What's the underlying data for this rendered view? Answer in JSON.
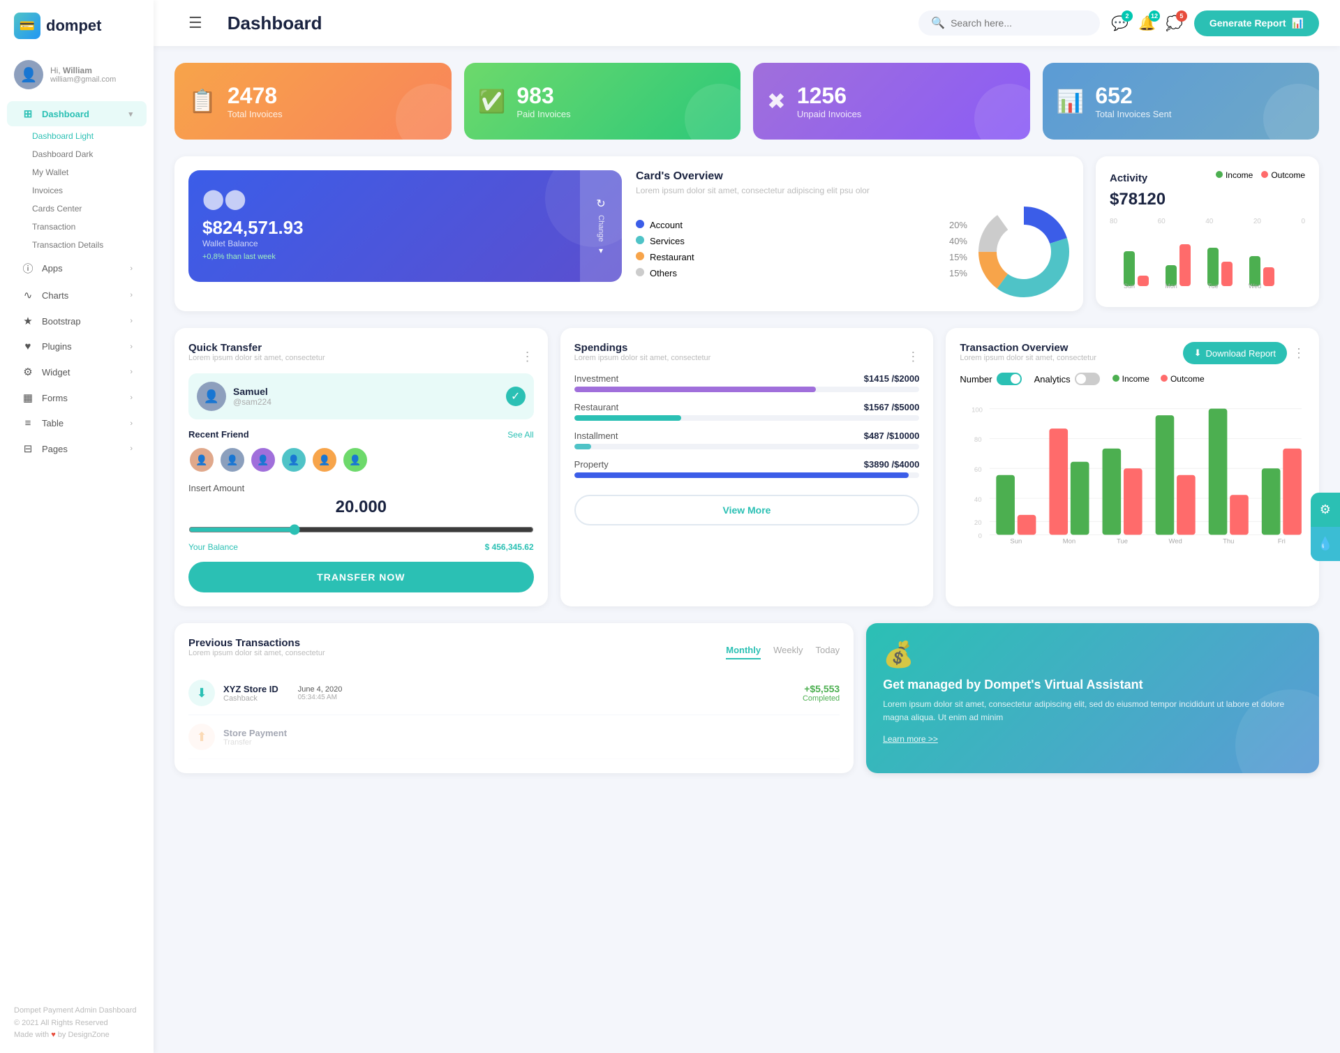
{
  "app": {
    "logo_text": "dompet",
    "page_title": "Dashboard",
    "footer_line1": "Dompet Payment Admin Dashboard",
    "footer_line2": "© 2021 All Rights Reserved",
    "footer_line3": "Made with ♥ by DesignZone"
  },
  "topbar": {
    "search_placeholder": "Search here...",
    "generate_btn": "Generate Report",
    "bell_badge": "12",
    "chat_badge": "2",
    "msg_badge": "5"
  },
  "user": {
    "greeting": "Hi, William",
    "name": "William",
    "email": "william@gmail.com"
  },
  "sidebar": {
    "items": [
      {
        "label": "Dashboard",
        "icon": "⊞",
        "active": true
      },
      {
        "label": "Apps",
        "icon": "ⓘ"
      },
      {
        "label": "Charts",
        "icon": "∿"
      },
      {
        "label": "Bootstrap",
        "icon": "★"
      },
      {
        "label": "Plugins",
        "icon": "♥"
      },
      {
        "label": "Widget",
        "icon": "⚙"
      },
      {
        "label": "Forms",
        "icon": "▦"
      },
      {
        "label": "Table",
        "icon": "≡"
      },
      {
        "label": "Pages",
        "icon": "⊟"
      }
    ],
    "sub_items": [
      "Dashboard Light",
      "Dashboard Dark",
      "My Wallet",
      "Invoices",
      "Cards Center",
      "Transaction",
      "Transaction Details"
    ]
  },
  "stat_cards": [
    {
      "num": "2478",
      "label": "Total Invoices",
      "icon": "📋",
      "color": "orange"
    },
    {
      "num": "983",
      "label": "Paid Invoices",
      "icon": "✅",
      "color": "green"
    },
    {
      "num": "1256",
      "label": "Unpaid Invoices",
      "icon": "✖",
      "color": "purple"
    },
    {
      "num": "652",
      "label": "Total Invoices Sent",
      "icon": "📊",
      "color": "blue-gray"
    }
  ],
  "wallet_card": {
    "amount": "$824,571.93",
    "label": "Wallet Balance",
    "change": "+0,8% than last week",
    "change_btn": "Change"
  },
  "card_overview": {
    "title": "Card's Overview",
    "desc": "Lorem ipsum dolor sit amet, consectetur adipiscing elit psu olor",
    "items": [
      {
        "label": "Account",
        "pct": "20%",
        "color": "#3b5de8"
      },
      {
        "label": "Services",
        "pct": "40%",
        "color": "#4fc3c7"
      },
      {
        "label": "Restaurant",
        "pct": "15%",
        "color": "#f7a44a"
      },
      {
        "label": "Others",
        "pct": "15%",
        "color": "#ccc"
      }
    ]
  },
  "activity": {
    "title": "Activity",
    "amount": "$78120",
    "legend_income": "Income",
    "legend_outcome": "Outcome",
    "bars": [
      {
        "day": "Sun",
        "income": 55,
        "outcome": 20
      },
      {
        "day": "Mon",
        "income": 30,
        "outcome": 65
      },
      {
        "day": "Tue",
        "income": 60,
        "outcome": 40
      },
      {
        "day": "Wed",
        "income": 45,
        "outcome": 30
      }
    ]
  },
  "quick_transfer": {
    "title": "Quick Transfer",
    "desc": "Lorem ipsum dolor sit amet, consectetur",
    "contact_name": "Samuel",
    "contact_handle": "@sam224",
    "recent_label": "Recent Friend",
    "see_all": "See All",
    "insert_amount_label": "Insert Amount",
    "amount_val": "20.000",
    "balance_label": "Your Balance",
    "balance_val": "$ 456,345.62",
    "transfer_btn": "TRANSFER NOW"
  },
  "spendings": {
    "title": "Spendings",
    "desc": "Lorem ipsum dolor sit amet, consectetur",
    "view_more": "View More",
    "items": [
      {
        "label": "Investment",
        "current": "$1415",
        "total": "$2000",
        "pct": 70,
        "color": "#a06fdb"
      },
      {
        "label": "Restaurant",
        "current": "$1567",
        "total": "$5000",
        "pct": 31,
        "color": "#2bc0b4"
      },
      {
        "label": "Installment",
        "current": "$487",
        "total": "$10000",
        "pct": 5,
        "color": "#4fc3c7"
      },
      {
        "label": "Property",
        "current": "$3890",
        "total": "$4000",
        "pct": 97,
        "color": "#3b5de8"
      }
    ]
  },
  "transaction_overview": {
    "title": "Transaction Overview",
    "desc": "Lorem ipsum dolor sit amet, consectetur",
    "download_btn": "Download Report",
    "toggle_number": "Number",
    "toggle_analytics": "Analytics",
    "legend_income": "Income",
    "legend_outcome": "Outcome",
    "bars": [
      {
        "day": "Sun",
        "income": 45,
        "outcome": 15
      },
      {
        "day": "Mon",
        "income": 80,
        "outcome": 55
      },
      {
        "day": "Tue",
        "income": 65,
        "outcome": 50
      },
      {
        "day": "Wed",
        "income": 90,
        "outcome": 45
      },
      {
        "day": "Thu",
        "income": 100,
        "outcome": 30
      },
      {
        "day": "Fri",
        "income": 50,
        "outcome": 65
      }
    ]
  },
  "prev_transactions": {
    "title": "Previous Transactions",
    "desc": "Lorem ipsum dolor sit amet, consectetur",
    "tabs": [
      "Monthly",
      "Weekly",
      "Today"
    ],
    "active_tab": "Monthly",
    "items": [
      {
        "name": "XYZ Store ID",
        "sub": "Cashback",
        "date": "June 4, 2020",
        "time": "05:34:45 AM",
        "amount": "+$5,553",
        "status": "Completed"
      }
    ]
  },
  "virtual_assistant": {
    "title": "Get managed by Dompet's Virtual Assistant",
    "desc": "Lorem ipsum dolor sit amet, consectetur adipiscing elit, sed do eiusmod tempor incididunt ut labore et dolore magna aliqua. Ut enim ad minim",
    "link": "Learn more >>"
  }
}
